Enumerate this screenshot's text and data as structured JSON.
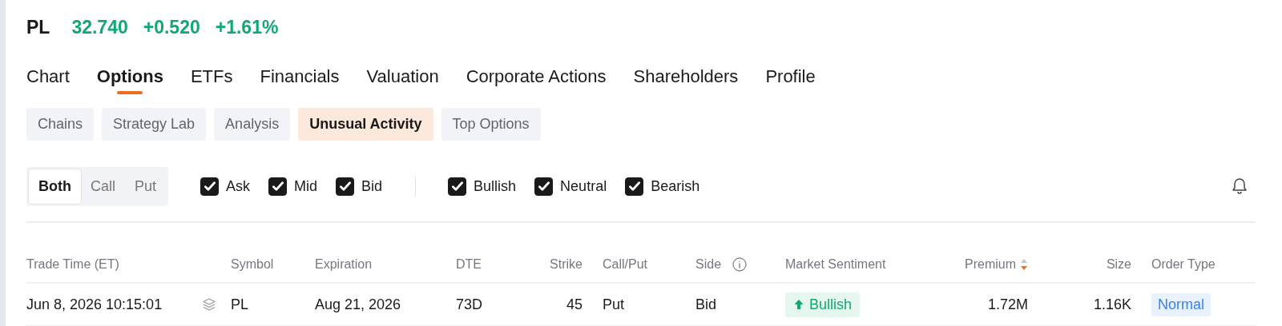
{
  "quote": {
    "symbol": "PL",
    "price": "32.740",
    "change": "+0.520",
    "change_pct": "+1.61%"
  },
  "tabs": [
    {
      "label": "Chart",
      "selected": false
    },
    {
      "label": "Options",
      "selected": true
    },
    {
      "label": "ETFs",
      "selected": false
    },
    {
      "label": "Financials",
      "selected": false
    },
    {
      "label": "Valuation",
      "selected": false
    },
    {
      "label": "Corporate Actions",
      "selected": false
    },
    {
      "label": "Shareholders",
      "selected": false
    },
    {
      "label": "Profile",
      "selected": false
    }
  ],
  "sub_tabs": [
    {
      "label": "Chains",
      "selected": false
    },
    {
      "label": "Strategy Lab",
      "selected": false
    },
    {
      "label": "Analysis",
      "selected": false
    },
    {
      "label": "Unusual Activity",
      "selected": true
    },
    {
      "label": "Top Options",
      "selected": false
    }
  ],
  "type_toggle": [
    {
      "label": "Both",
      "selected": true
    },
    {
      "label": "Call",
      "selected": false
    },
    {
      "label": "Put",
      "selected": false
    }
  ],
  "side_filters": [
    {
      "label": "Ask",
      "checked": true
    },
    {
      "label": "Mid",
      "checked": true
    },
    {
      "label": "Bid",
      "checked": true
    }
  ],
  "sentiment_filters": [
    {
      "label": "Bullish",
      "checked": true
    },
    {
      "label": "Neutral",
      "checked": true
    },
    {
      "label": "Bearish",
      "checked": true
    }
  ],
  "table": {
    "columns": [
      {
        "label": "Trade Time (ET)"
      },
      {
        "label": "Symbol"
      },
      {
        "label": "Expiration"
      },
      {
        "label": "DTE"
      },
      {
        "label": "Strike"
      },
      {
        "label": "Call/Put"
      },
      {
        "label": "Side",
        "info": true
      },
      {
        "label": "Market Sentiment"
      },
      {
        "label": "Premium",
        "sort_descending": true
      },
      {
        "label": "Size"
      },
      {
        "label": "Order Type"
      }
    ],
    "rows": [
      {
        "cells": [
          {
            "text": "Jun 8, 2026 10:15:01",
            "kind": "text"
          },
          {
            "text": "PL",
            "kind": "text"
          },
          {
            "text": "Aug 21, 2026",
            "kind": "text"
          },
          {
            "text": "73D",
            "kind": "text"
          },
          {
            "text": "45",
            "kind": "text"
          },
          {
            "text": "Put",
            "kind": "text"
          },
          {
            "text": "Bid",
            "kind": "text"
          },
          {
            "text": "Bullish",
            "kind": "bullish"
          },
          {
            "text": "1.72M",
            "kind": "text"
          },
          {
            "text": "1.16K",
            "kind": "text"
          },
          {
            "text": "Normal",
            "kind": "tag"
          }
        ]
      }
    ]
  }
}
